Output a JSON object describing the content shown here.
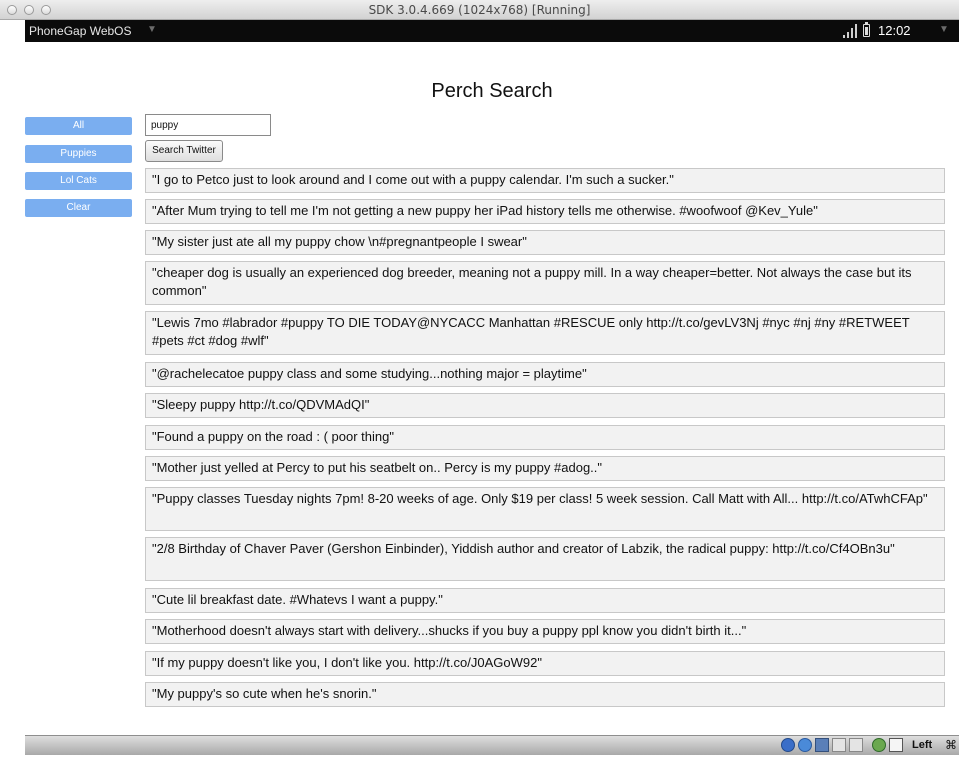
{
  "window": {
    "title": "SDK 3.0.4.669 (1024x768) [Running]"
  },
  "statusbar": {
    "app_name": "PhoneGap WebOS",
    "menu_arrow": "▼",
    "time": "12:02",
    "status_arrow": "▼",
    "icons": [
      "signal-icon",
      "battery-icon"
    ]
  },
  "app": {
    "title": "Perch Search",
    "sidebar": [
      {
        "label": "All"
      },
      {
        "label": "Puppies"
      },
      {
        "label": "Lol Cats"
      },
      {
        "label": "Clear"
      }
    ],
    "search": {
      "value": "puppy",
      "button_label": "Search Twitter"
    },
    "tweets": [
      "\"I go to Petco just to look around and I come out with a puppy calendar. I'm such a sucker.\"",
      "\"After Mum trying to tell me I'm not getting a new puppy her iPad history tells me otherwise. #woofwoof @Kev_Yule\"",
      "\"My sister just ate all my puppy chow \\n#pregnantpeople I swear\"",
      "\"cheaper dog is usually an experienced dog breeder, meaning not a puppy mill. In a way cheaper=better. Not always the case but its common\"",
      "\"Lewis 7mo #labrador #puppy TO DIE TODAY@NYCACC Manhattan #RESCUE only http://t.co/gevLV3Nj #nyc #nj #ny #RETWEET #pets #ct #dog #wlf\"",
      "\"@rachelecatoe puppy class and some studying...nothing major = playtime\"",
      "\"Sleepy puppy http://t.co/QDVMAdQI\"",
      "\"Found a puppy on the road : ( poor thing\"",
      "\"Mother just yelled at Percy to put his seatbelt on.. Percy is my puppy #adog..\"",
      "\"Puppy classes Tuesday nights 7pm! 8-20 weeks of age. Only $19 per class! 5 week session. Call Matt with All... http://t.co/ATwhCFAp\"",
      "\"2/8 Birthday of Chaver Paver (Gershon Einbinder), Yiddish author and creator of Labzik, the radical puppy: http://t.co/Cf4OBn3u\"",
      "\"Cute lil breakfast date. #Whatevs I want a puppy.\"",
      "\"Motherhood doesn't always start with delivery...shucks if you buy a puppy ppl know you didn't birth it...\"",
      "\"If my puppy doesn't like you, I don't like you. http://t.co/J0AGoW92\"",
      "\"My puppy's so cute when he's snorin.\""
    ]
  },
  "bottombar": {
    "key_label": "Left",
    "cmd_symbol": "⌘",
    "icons": [
      "disk-icon",
      "network-icon",
      "usb-icon",
      "folder-icon",
      "display-icon",
      "globe-icon",
      "download-icon"
    ]
  },
  "colors": {
    "sidebar_button": "#7aaef0",
    "statusbar": "#0b0b0b",
    "tweet_bg": "#f2f2f2"
  }
}
